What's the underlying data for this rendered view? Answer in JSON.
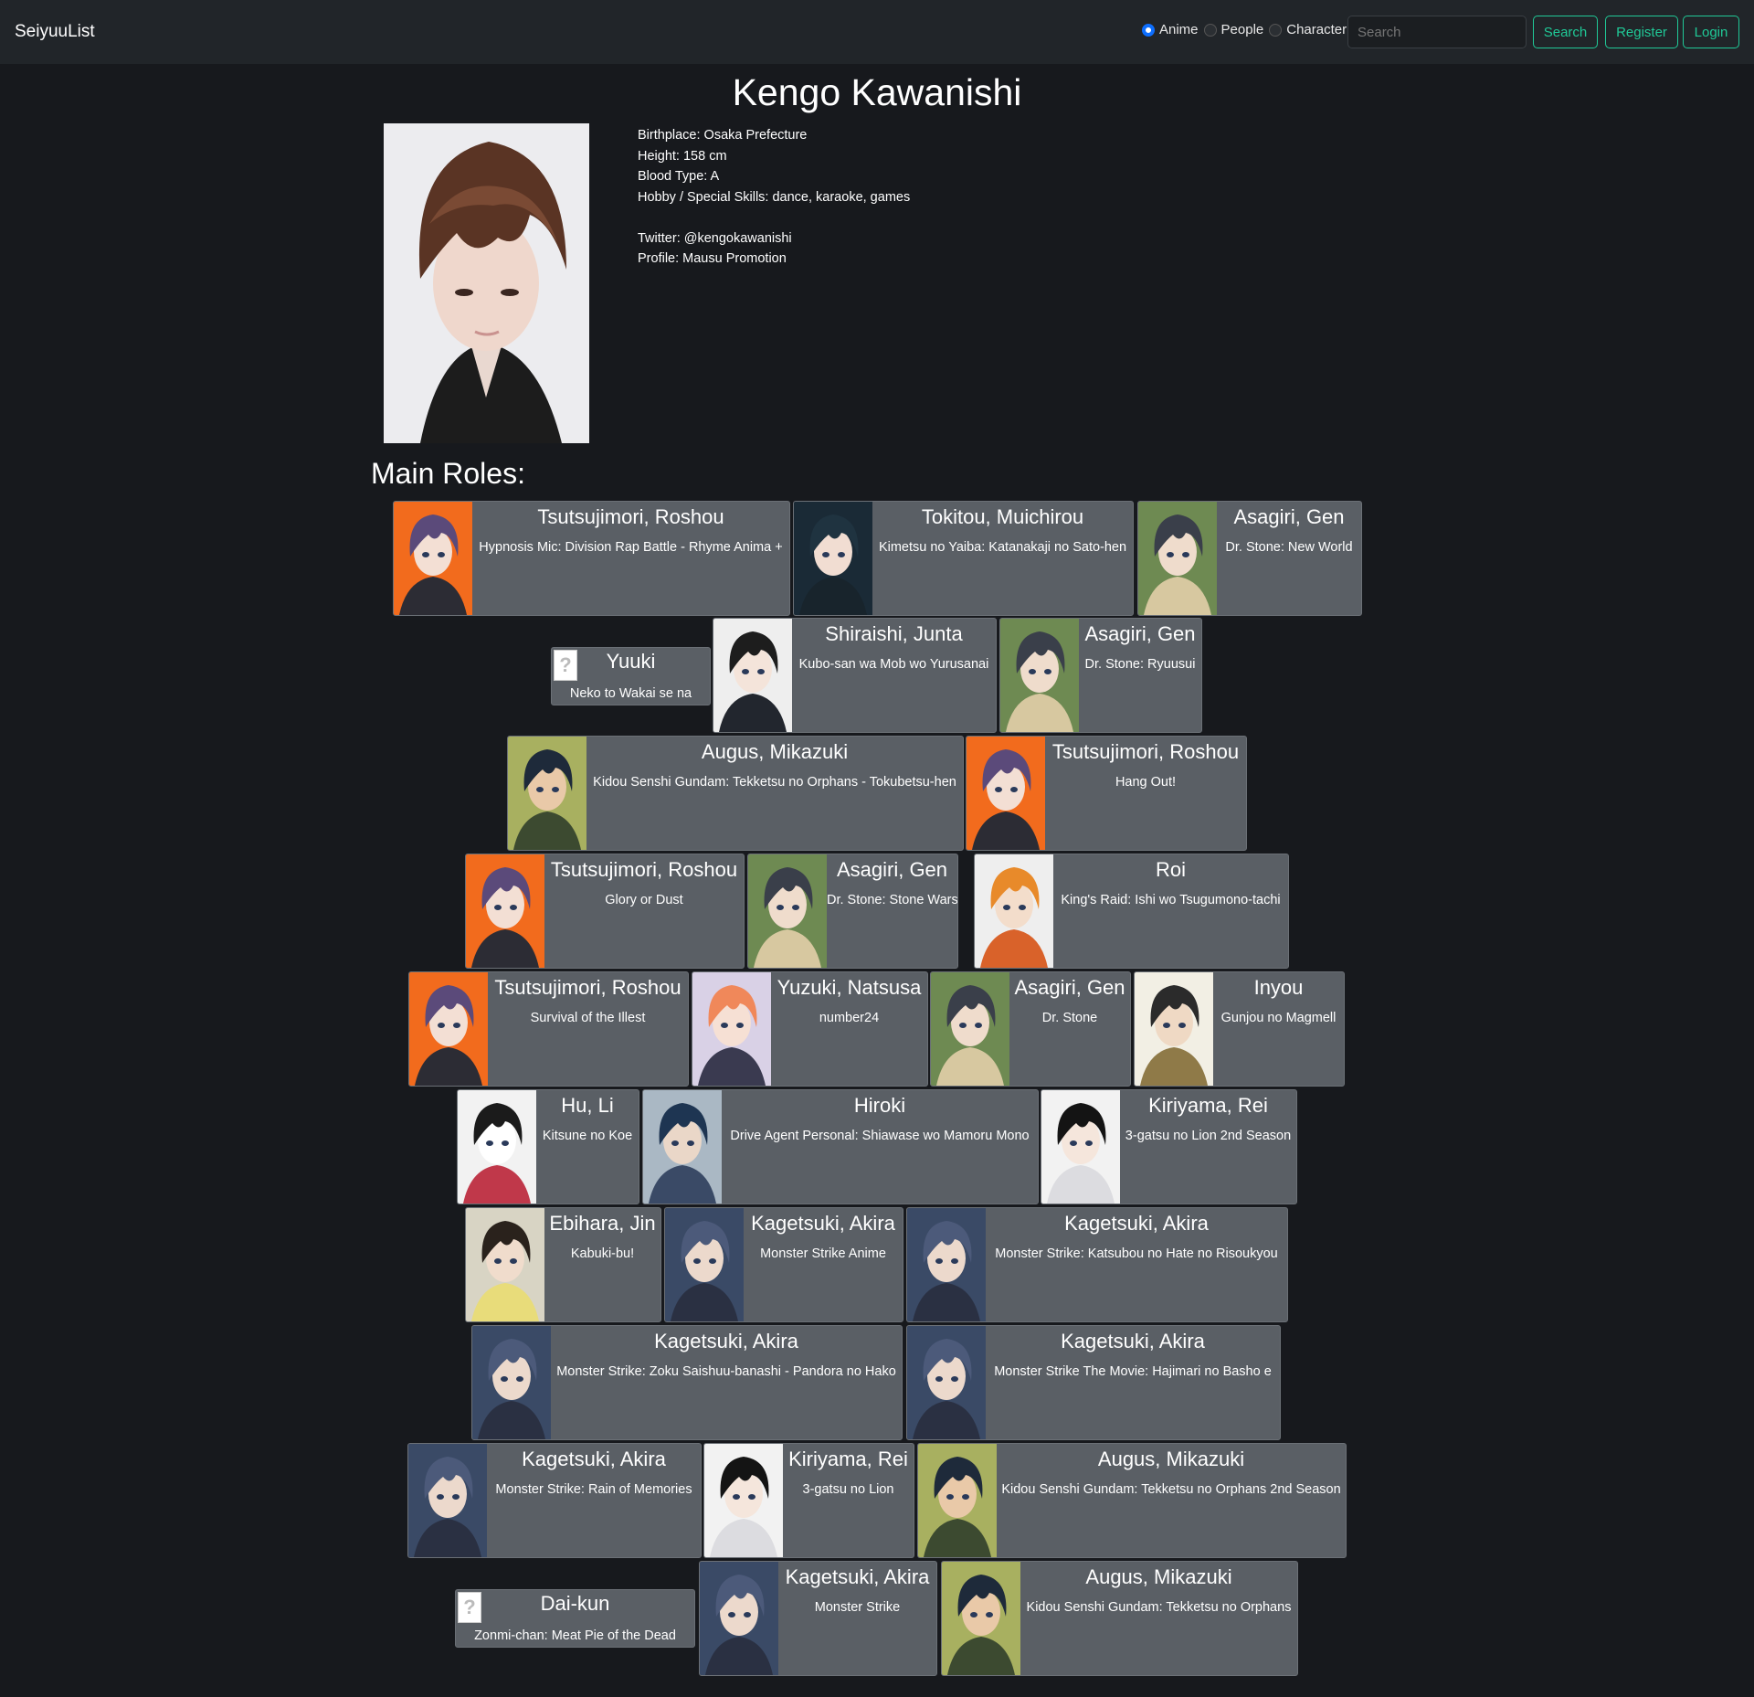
{
  "nav": {
    "brand": "SeiyuuList",
    "radio_options": [
      {
        "label": "Anime",
        "selected": true
      },
      {
        "label": "People",
        "selected": false
      },
      {
        "label": "Character",
        "selected": false
      }
    ],
    "search_placeholder": "Search",
    "search_label": "Search",
    "register_label": "Register",
    "login_label": "Login"
  },
  "person": {
    "name": "Kengo Kawanishi",
    "details": [
      "Birthplace: Osaka Prefecture",
      "Height: 158 cm",
      "Blood Type: A",
      "Hobby / Special Skills: dance, karaoke, games",
      "",
      "Twitter: @kengokawanishi",
      "Profile: Mausu Promotion"
    ]
  },
  "roles_heading": "Main Roles:",
  "roles": [
    {
      "character": "Tsutsujimori, Roshou",
      "show": "Hypnosis Mic: Division Rap Battle - Rhyme Anima +"
    },
    {
      "character": "Tokitou, Muichirou",
      "show": "Kimetsu no Yaiba: Katanakaji no Sato-hen"
    },
    {
      "character": "Asagiri, Gen",
      "show": "Dr. Stone: New World"
    },
    {
      "character": "Yuuki",
      "show": "Neko to Wakai se na"
    },
    {
      "character": "Shiraishi, Junta",
      "show": "Kubo-san wa Mob wo Yurusanai"
    },
    {
      "character": "Asagiri, Gen",
      "show": "Dr. Stone: Ryuusui"
    },
    {
      "character": "Augus, Mikazuki",
      "show": "Kidou Senshi Gundam: Tekketsu no Orphans - Tokubetsu-hen"
    },
    {
      "character": "Tsutsujimori, Roshou",
      "show": "Hang Out!"
    },
    {
      "character": "Tsutsujimori, Roshou",
      "show": "Glory or Dust"
    },
    {
      "character": "Asagiri, Gen",
      "show": "Dr. Stone: Stone Wars"
    },
    {
      "character": "Roi",
      "show": "King's Raid: Ishi wo Tsugumono-tachi"
    },
    {
      "character": "Tsutsujimori, Roshou",
      "show": "Survival of the Illest"
    },
    {
      "character": "Yuzuki, Natsusa",
      "show": "number24"
    },
    {
      "character": "Asagiri, Gen",
      "show": "Dr. Stone"
    },
    {
      "character": "Inyou",
      "show": "Gunjou no Magmell"
    },
    {
      "character": "Hu, Li",
      "show": "Kitsune no Koe"
    },
    {
      "character": "Hiroki",
      "show": "Drive Agent Personal: Shiawase wo Mamoru Mono"
    },
    {
      "character": "Kiriyama, Rei",
      "show": "3-gatsu no Lion 2nd Season"
    },
    {
      "character": "Ebihara, Jin",
      "show": "Kabuki-bu!"
    },
    {
      "character": "Kagetsuki, Akira",
      "show": "Monster Strike Anime"
    },
    {
      "character": "Kagetsuki, Akira",
      "show": "Monster Strike: Katsubou no Hate no Risoukyou"
    },
    {
      "character": "Kagetsuki, Akira",
      "show": "Monster Strike: Zoku Saishuu-banashi - Pandora no Hako"
    },
    {
      "character": "Kagetsuki, Akira",
      "show": "Monster Strike The Movie: Hajimari no Basho e"
    },
    {
      "character": "Kagetsuki, Akira",
      "show": "Monster Strike: Rain of Memories"
    },
    {
      "character": "Kiriyama, Rei",
      "show": "3-gatsu no Lion"
    },
    {
      "character": "Augus, Mikazuki",
      "show": "Kidou Senshi Gundam: Tekketsu no Orphans 2nd Season"
    },
    {
      "character": "Dai-kun",
      "show": "Zonmi-chan: Meat Pie of the Dead"
    },
    {
      "character": "Kagetsuki, Akira",
      "show": "Monster Strike"
    },
    {
      "character": "Augus, Mikazuki",
      "show": "Kidou Senshi Gundam: Tekketsu no Orphans"
    }
  ]
}
